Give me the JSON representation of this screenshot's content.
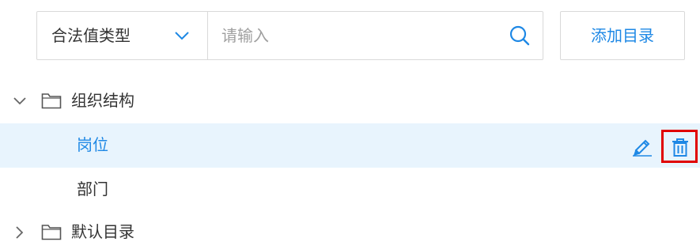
{
  "toolbar": {
    "type_select": {
      "selected": "合法值类型"
    },
    "search": {
      "placeholder": "请输入",
      "value": ""
    },
    "add_button_label": "添加目录"
  },
  "tree": {
    "nodes": [
      {
        "label": "组织结构",
        "type": "folder",
        "expanded": true,
        "children": [
          {
            "label": "岗位",
            "selected": true,
            "actions": [
              "edit-icon",
              "delete-icon"
            ]
          },
          {
            "label": "部门",
            "selected": false
          }
        ]
      },
      {
        "label": "默认目录",
        "type": "folder",
        "expanded": false
      }
    ]
  },
  "colors": {
    "accent": "#1e88e5",
    "selected_row_bg": "#e8f4fd",
    "highlight_box": "#e00000",
    "border": "#d9d9d9",
    "text": "#333333",
    "placeholder": "#a0a0a0"
  },
  "icons": {
    "select_chevron": "chevron-down-icon",
    "search": "search-icon",
    "expand": "chevron-down-icon",
    "collapse": "chevron-right-icon",
    "folder": "folder-icon",
    "edit": "pencil-icon",
    "delete": "trash-icon"
  }
}
